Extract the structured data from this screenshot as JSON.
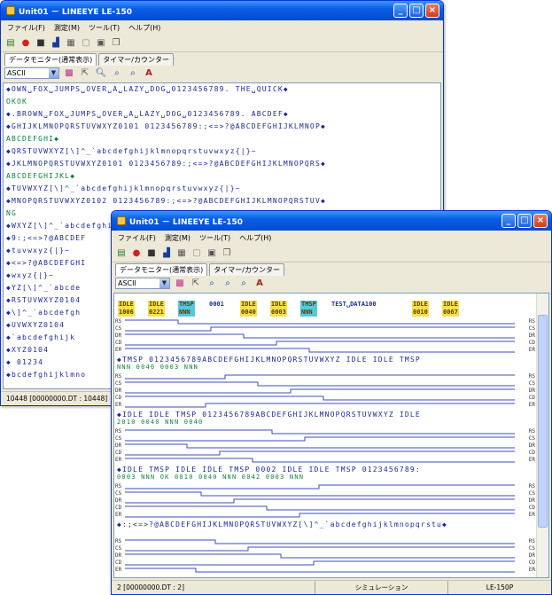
{
  "window_back": {
    "title": "Unit01 － LINEEYE LE-150",
    "menu": [
      "ファイル(F)",
      "測定(M)",
      "ツール(T)",
      "ヘルプ(H)"
    ],
    "tabs": [
      "データモニター(通常表示)",
      "タイマー/カウンター"
    ],
    "format": "ASCII",
    "lines": [
      {
        "t": "sd",
        "text": "◆OWN␣FOX␣JUMPS␣OVER␣A␣LAZY␣DOG␣0123456789.     THE␣QUICK◆"
      },
      {
        "t": "rd",
        "text": "                                          OKOK"
      },
      {
        "t": "sd",
        "text": "◆.BROWN␣FOX␣JUMPS␣OVER␣A␣LAZY␣DOG␣0123456789.      ABCDEF◆"
      },
      {
        "t": "sd",
        "text": "◆GHIJKLMNOPQRSTUVWXYZ0101    0123456789:;<=>?@ABCDEFGHIJKLMNOP◆"
      },
      {
        "t": "rd",
        "text": "                                                 ABCDEFGHI◆"
      },
      {
        "t": "sd",
        "text": "◆QRSTUVWXYZ[\\]^_`abcdefghijklmnopqrstuvwxyz{|}~ "
      },
      {
        "t": "sd",
        "text": "◆JKLMNOPQRSTUVWXYZ0101       0123456789:;<=>?@ABCDEFGHIJKLMNOPQRS◆"
      },
      {
        "t": "rd",
        "text": "                                                 ABCDEFGHIJKL◆"
      },
      {
        "t": "sd",
        "text": "◆TUVWXYZ[\\]^_`abcdefghijklmnopqrstuvwxyz{|}~ "
      },
      {
        "t": "sd",
        "text": "◆MNOPQRSTUVWXYZ0102    0123456789:;<=>?@ABCDEFGHIJKLMNOPQRSTUV◆"
      },
      {
        "t": "rd",
        "text": "                              NG"
      },
      {
        "t": "sd",
        "text": "◆WXYZ[\\]^_`abcdefghijklmnopqrstuvwxyz{|}~      0123456789◆"
      },
      {
        "t": "sd",
        "text": "◆9:;<=>?@ABCDEF"
      },
      {
        "t": "sd",
        "text": "◆tuvwxyz{|}~"
      },
      {
        "t": "sd",
        "text": "◆<=>?@ABCDEFGHI"
      },
      {
        "t": "sd",
        "text": "◆wxyz{|}~"
      },
      {
        "t": "sd",
        "text": "◆YZ[\\]^_`abcde"
      },
      {
        "t": "sd",
        "text": "◆RSTUVWXYZ0104"
      },
      {
        "t": "sd",
        "text": "◆\\]^_`abcdefgh"
      },
      {
        "t": "sd",
        "text": "◆UVWXYZ0104"
      },
      {
        "t": "sd",
        "text": "◆`abcdefghijk"
      },
      {
        "t": "sd",
        "text": "◆XYZ0104"
      },
      {
        "t": "sd",
        "text": "◆ 01234"
      },
      {
        "t": "sd",
        "text": "◆bcdefghijklmno"
      }
    ],
    "status": "10448 [00000000.DT : 10448]"
  },
  "window_front": {
    "title": "Unit01 － LINEEYE LE-150",
    "menu": [
      "ファイル(F)",
      "測定(M)",
      "ツール(T)",
      "ヘルプ(H)"
    ],
    "tabs": [
      "データモニター(通常表示)",
      "タイマー/カウンター"
    ],
    "format": "ASCII",
    "blocks": [
      {
        "labels": [
          {
            "k": "idle",
            "a": "IDLE",
            "b": "1006"
          },
          {
            "k": "idle",
            "a": "IDLE",
            "b": "0221"
          },
          {
            "k": "tmsp",
            "a": "TMSP",
            "b": "NNN"
          },
          {
            "k": "text",
            "a": "0001"
          },
          {
            "k": "idle",
            "a": "IDLE",
            "b": "0040"
          },
          {
            "k": "idle",
            "a": "IDLE",
            "b": "0003"
          },
          {
            "k": "tmsp",
            "a": "TMSP",
            "b": "NNN"
          },
          {
            "k": "text",
            "a": "TEST␣DATA100"
          },
          {
            "k": "idle",
            "a": "IDLE",
            "b": "0010"
          },
          {
            "k": "idle",
            "a": "IDLE",
            "b": "0067"
          }
        ]
      },
      {
        "text": "TMSP 0123456789ABCDEFGHIJKLMNOPQRSTUVWXYZ   IDLE IDLE TMSP",
        "sub": "NNN                                          0040 0003 NNN"
      },
      {
        "text": "IDLE IDLE TMSP 0123456789ABCDEFGHIJKLMNOPQRSTUVWXYZ  IDLE",
        "sub": "2010 0040 NNN                                       0040"
      },
      {
        "text": "IDLE TMSP          IDLE IDLE TMSP  0002 IDLE IDLE TMSP  0123456789:",
        "sub": "0003 NNN OK 0010 0040 NNN       0042 0003 NNN"
      },
      {
        "text": ":;<=>?@ABCDEFGHIJKLMNOPQRSTUVWXYZ[\\]^_`abcdefghijklmnopqrstu◆"
      }
    ],
    "signals": [
      "RS",
      "CS",
      "DR",
      "CD",
      "ER"
    ],
    "status_left": "2 [00000000.DT : 2]",
    "status_mid": "シミュレーション",
    "status_right": "LE-150P"
  }
}
